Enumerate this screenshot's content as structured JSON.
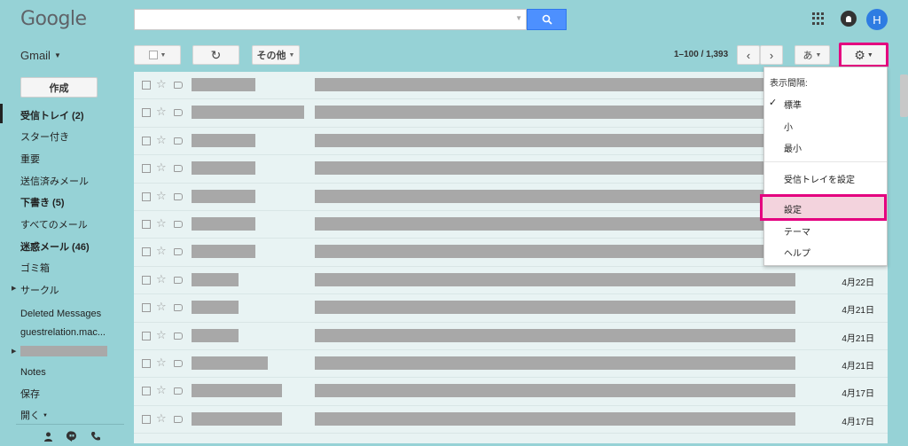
{
  "brand": {
    "logo_text": "Google"
  },
  "header": {
    "avatar_letter": "H"
  },
  "toolbar": {
    "app_label": "Gmail",
    "more_label": "その他",
    "pager": "1–100 / 1,393",
    "input_tool_label": "あ"
  },
  "sidebar": {
    "compose_label": "作成",
    "items": [
      {
        "label": "受信トレイ (2)",
        "bold": true
      },
      {
        "label": "スター付き"
      },
      {
        "label": "重要"
      },
      {
        "label": "送信済みメール"
      },
      {
        "label": "下書き (5)",
        "bold": true
      },
      {
        "label": "すべてのメール"
      },
      {
        "label": "迷惑メール (46)",
        "bold": true
      },
      {
        "label": "ゴミ箱"
      },
      {
        "label": "サークル"
      },
      {
        "label": "Deleted Messages"
      },
      {
        "label": "guestrelation.mac..."
      },
      {
        "label": "Notes"
      },
      {
        "label": "保存"
      },
      {
        "label": "開く"
      }
    ]
  },
  "mail_rows": [
    {
      "date": ""
    },
    {
      "date": ""
    },
    {
      "date": ""
    },
    {
      "date": ""
    },
    {
      "date": ""
    },
    {
      "date": ""
    },
    {
      "date": ""
    },
    {
      "date": "4月22日"
    },
    {
      "date": "4月21日"
    },
    {
      "date": "4月21日"
    },
    {
      "date": "4月21日"
    },
    {
      "date": "4月17日"
    },
    {
      "date": "4月17日"
    }
  ],
  "settings_menu": {
    "heading": "表示間隔:",
    "density": [
      "標準",
      "小",
      "最小"
    ],
    "configure_inbox": "受信トレイを設定",
    "settings": "設定",
    "themes": "テーマ",
    "help": "ヘルプ"
  },
  "colors": {
    "background": "#96d2d6",
    "highlight_border": "#e4007f",
    "search_button": "#4d90fe",
    "avatar": "#2e7ce2"
  }
}
